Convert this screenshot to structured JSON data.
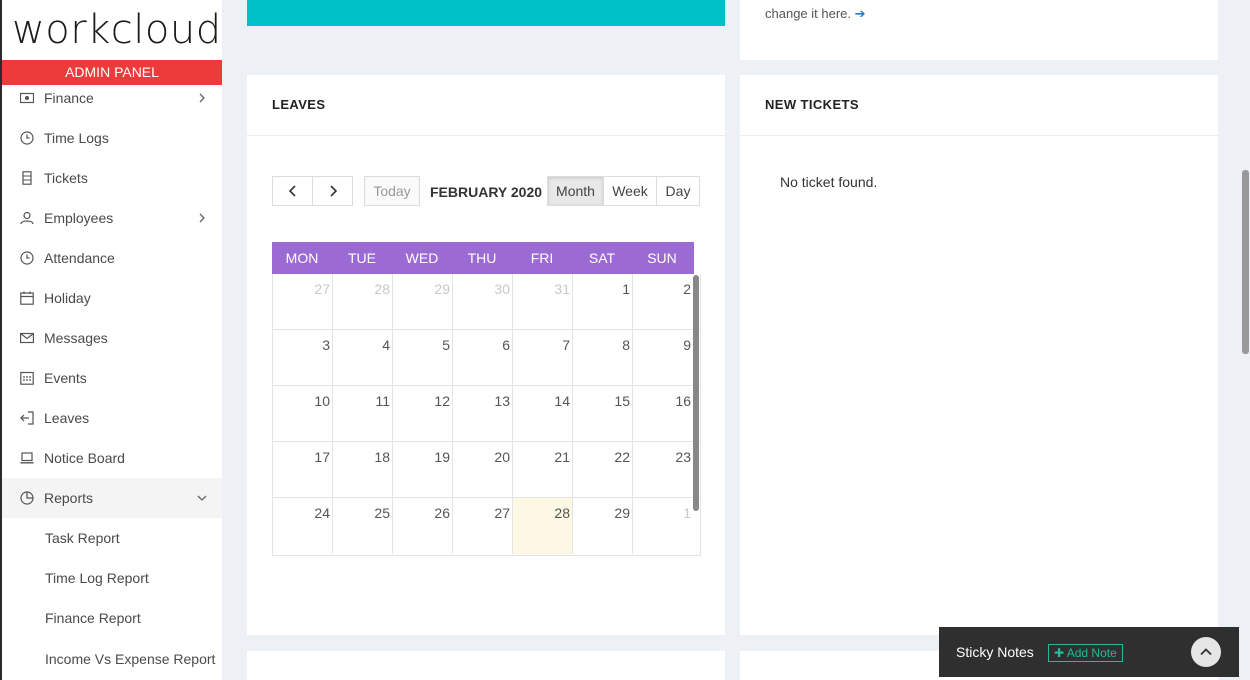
{
  "brand": {
    "logo_text": "workcloud",
    "panel_label": "ADMIN PANEL"
  },
  "sidebar": {
    "items": [
      {
        "label": "Finance",
        "icon": "money-icon",
        "has_submenu": true
      },
      {
        "label": "Time Logs",
        "icon": "clock-icon"
      },
      {
        "label": "Tickets",
        "icon": "ticket-icon"
      },
      {
        "label": "Employees",
        "icon": "user-icon",
        "has_submenu": true
      },
      {
        "label": "Attendance",
        "icon": "clock-icon"
      },
      {
        "label": "Holiday",
        "icon": "calendar-icon"
      },
      {
        "label": "Messages",
        "icon": "envelope-icon"
      },
      {
        "label": "Events",
        "icon": "calendar-grid-icon"
      },
      {
        "label": "Leaves",
        "icon": "sign-out-icon"
      },
      {
        "label": "Notice Board",
        "icon": "laptop-icon"
      },
      {
        "label": "Reports",
        "icon": "pie-chart-icon",
        "expanded": true
      }
    ],
    "report_subitems": [
      {
        "label": "Task Report"
      },
      {
        "label": "Time Log Report"
      },
      {
        "label": "Finance Report"
      },
      {
        "label": "Income Vs Expense Report"
      }
    ]
  },
  "top_right": {
    "link_text": "change it here."
  },
  "leaves": {
    "title": "LEAVES",
    "toolbar": {
      "today": "Today",
      "month_title": "FEBRUARY 2020",
      "views": [
        "Month",
        "Week",
        "Day"
      ],
      "active_view": "Month"
    },
    "weekdays": [
      "MON",
      "TUE",
      "WED",
      "THU",
      "FRI",
      "SAT",
      "SUN"
    ],
    "weeks": [
      [
        "27",
        "28",
        "29",
        "30",
        "31",
        "1",
        "2"
      ],
      [
        "3",
        "4",
        "5",
        "6",
        "7",
        "8",
        "9"
      ],
      [
        "10",
        "11",
        "12",
        "13",
        "14",
        "15",
        "16"
      ],
      [
        "17",
        "18",
        "19",
        "20",
        "21",
        "22",
        "23"
      ],
      [
        "24",
        "25",
        "26",
        "27",
        "28",
        "29",
        "1"
      ]
    ],
    "today_date": "28"
  },
  "tickets": {
    "title": "NEW TICKETS",
    "empty_text": "No ticket found."
  },
  "sticky_notes": {
    "title": "Sticky Notes",
    "add_label": "Add Note"
  },
  "colors": {
    "admin_bar": "#ed3b3b",
    "teal": "#00c0c8",
    "calendar_header": "#9b6bd3",
    "today_highlight": "#fcf8e3",
    "add_note": "#26b99a"
  }
}
